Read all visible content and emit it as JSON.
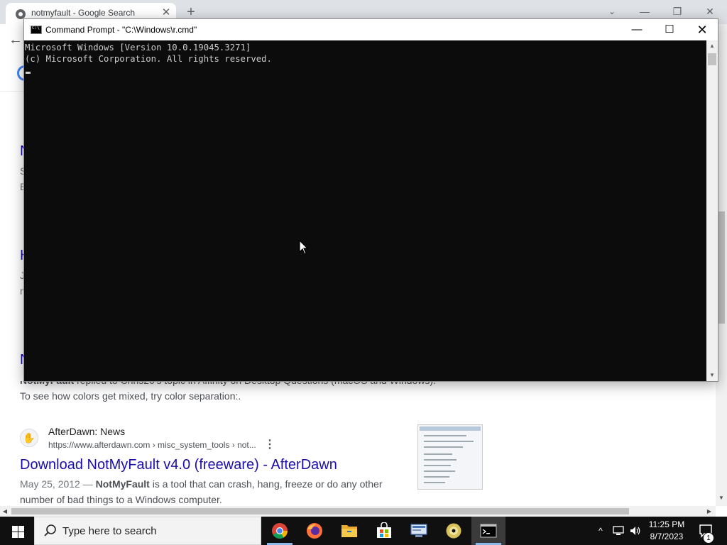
{
  "browser": {
    "tab_title": "notmyfault - Google Search",
    "new_tab_label": "+",
    "tab_close_label": "✕",
    "win_chevron": "⌄",
    "win_min": "—",
    "win_max": "❐",
    "win_close": "✕",
    "back_label": "←",
    "results": {
      "fragments": [
        {
          "text": "N",
          "kind": "link"
        },
        {
          "text": "S",
          "kind": "gray"
        },
        {
          "text": "E",
          "kind": "gray"
        },
        {
          "text": "H",
          "kind": "link"
        },
        {
          "text": "J",
          "kind": "gray"
        },
        {
          "text": "n",
          "kind": "gray"
        },
        {
          "text": "N",
          "kind": "link"
        }
      ],
      "partial_snippet_bold": "NotMyFault",
      "partial_snippet_rest": " replied to Chris20's topic in Affinity on Desktop Questions (macOS and Windows).",
      "snippet_line": "To see how colors get mixed, try color separation:.",
      "afterdawn": {
        "site_name": "AfterDawn: News",
        "url": "https://www.afterdawn.com › misc_system_tools › not...",
        "more_label": "⋮",
        "title": "Download NotMyFault v4.0 (freeware) - AfterDawn",
        "snippet_date": "May 25, 2012 — ",
        "snippet_bold": "NotMyFault",
        "snippet_rest": " is a tool that can crash, hang, freeze or do any other",
        "snippet_line2": "number of bad things to a Windows computer."
      }
    }
  },
  "cmd": {
    "title": "Command Prompt - \"C:\\Windows\\r.cmd\"",
    "min_label": "—",
    "max_label": "☐",
    "close_label": "✕",
    "lines": [
      "Microsoft Windows [Version 10.0.19045.3271]",
      "(c) Microsoft Corporation. All rights reserved."
    ]
  },
  "taskbar": {
    "search_placeholder": "Type here to search",
    "apps": [
      "chrome-icon",
      "firefox-icon",
      "file-explorer-icon",
      "microsoft-store-icon",
      "network-tool-icon",
      "disc-burner-icon",
      "command-prompt-icon"
    ],
    "tray_chevron": "^",
    "time": "11:25 PM",
    "date": "8/7/2023",
    "notification_count": "1"
  }
}
